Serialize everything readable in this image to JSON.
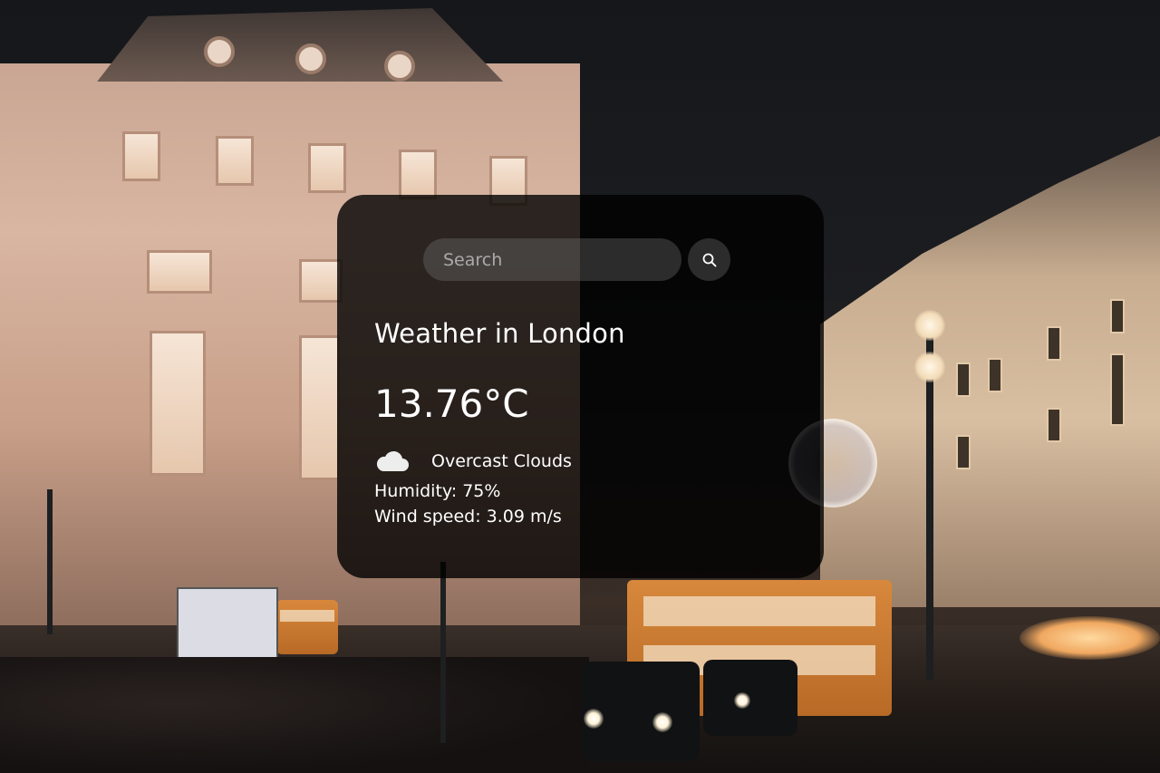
{
  "search": {
    "placeholder": "Search"
  },
  "weather": {
    "city_title": "Weather in London",
    "temperature": "13.76°C",
    "condition": "Overcast Clouds",
    "humidity": "Humidity: 75%",
    "wind_speed": "Wind speed: 3.09 m/s"
  },
  "icons": {
    "search": "search-icon",
    "weather": "cloud-icon"
  },
  "colors": {
    "card_background": "#000000cc",
    "text": "#ffffff",
    "input_background": "#7c7c7c54"
  }
}
